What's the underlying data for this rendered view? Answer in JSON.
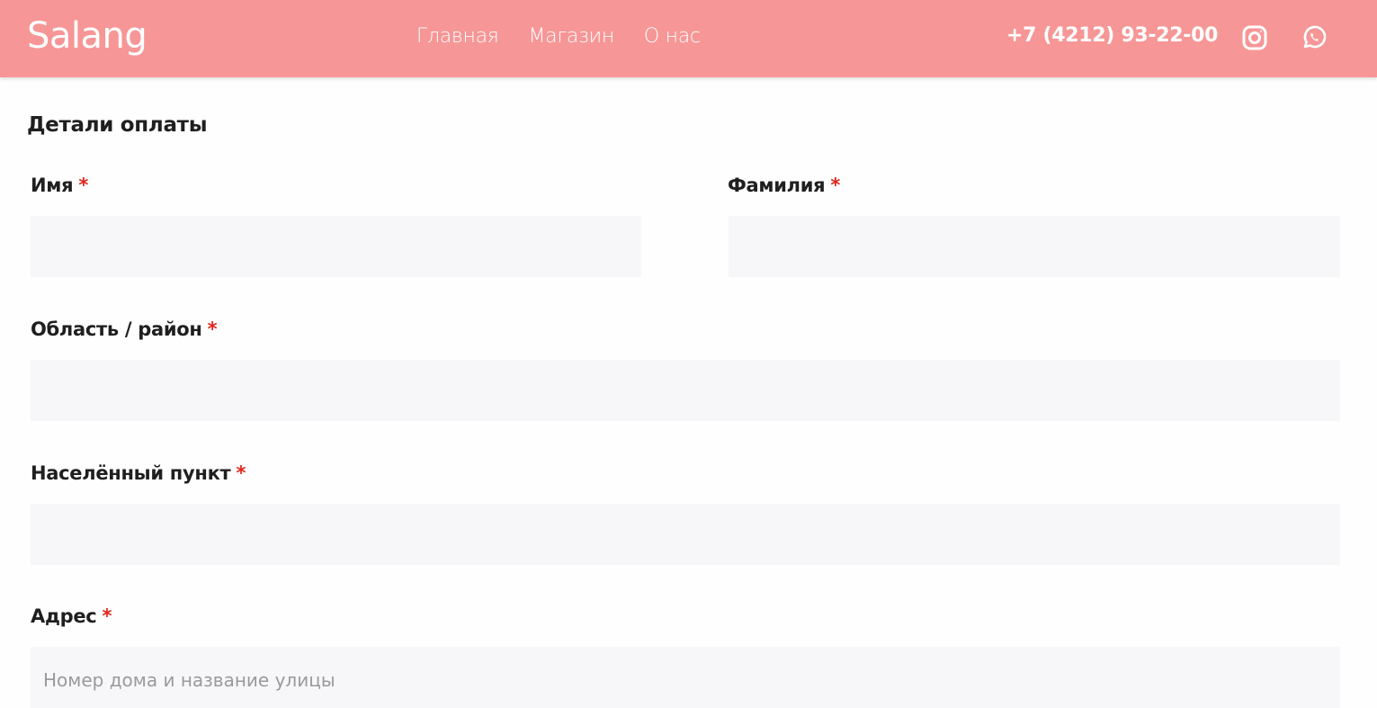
{
  "header": {
    "logo": "Salang",
    "nav": [
      {
        "label": "Главная"
      },
      {
        "label": "Магазин"
      },
      {
        "label": "О нас"
      }
    ],
    "phone": "+7 (4212) 93-22-00",
    "icons": [
      "instagram-icon",
      "whatsapp-icon"
    ],
    "background_color": "#f79696"
  },
  "form": {
    "title": "Детали оплаты",
    "required_mark": "*",
    "fields": {
      "first_name": {
        "label": "Имя",
        "value": "",
        "placeholder": ""
      },
      "last_name": {
        "label": "Фамилия",
        "value": "",
        "placeholder": ""
      },
      "region": {
        "label": "Область / район",
        "value": "",
        "placeholder": ""
      },
      "city": {
        "label": "Населённый пункт",
        "value": "",
        "placeholder": ""
      },
      "address": {
        "label": "Адрес",
        "value": "",
        "placeholder": "Номер дома и название улицы"
      }
    },
    "required_color": "#e2261d",
    "input_background": "#f7f6f9"
  }
}
